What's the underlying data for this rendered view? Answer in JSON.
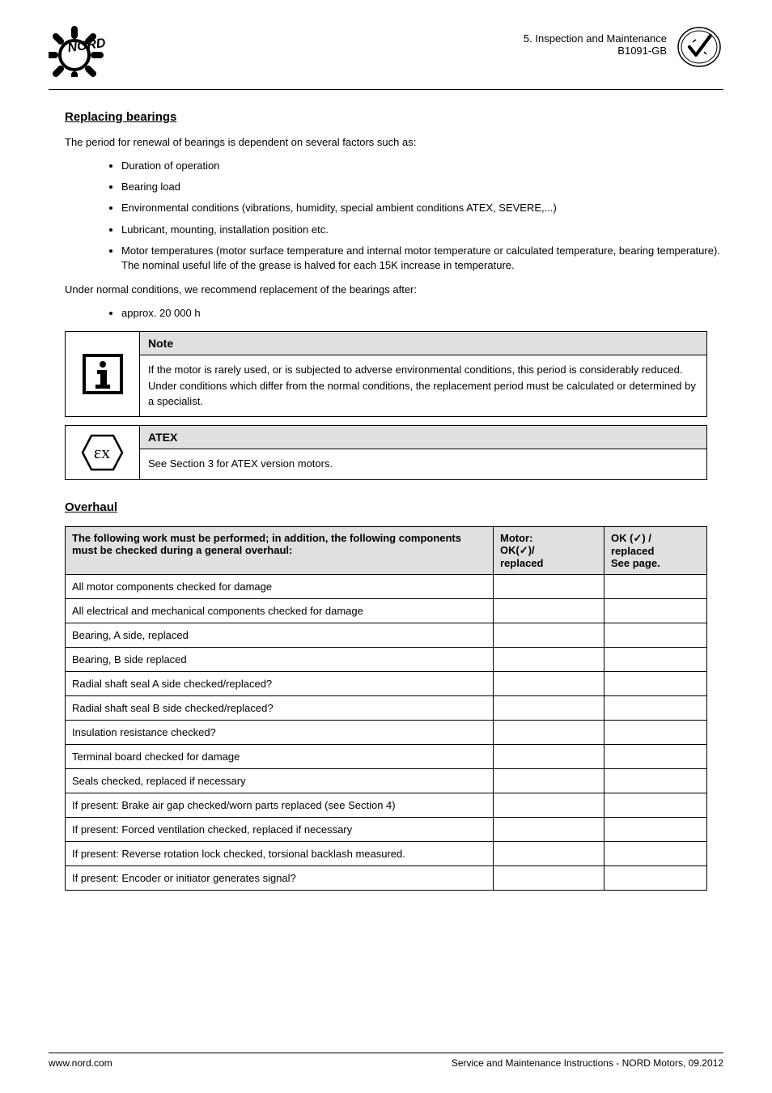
{
  "header": {
    "chapter": "5. Inspection and Maintenance",
    "doc_ref": "B1091-GB"
  },
  "sections": {
    "replacing_title": "Replacing bearings",
    "replacing_intro": "The period for renewal of bearings is dependent on several factors such as:",
    "factors": [
      "Duration of operation",
      "Bearing load",
      "Environmental conditions (vibrations, humidity, special ambient conditions ATEX, SEVERE,...)",
      "Lubricant, mounting, installation position etc.",
      "Motor temperatures (motor surface temperature and internal motor temperature or calculated temperature, bearing temperature). The nominal useful life of the grease is halved for each 15K increase in temperature."
    ],
    "replacing_conclusion": "Under normal conditions, we recommend replacement of the bearings after:",
    "replacing_hours": "approx. 20 000 h"
  },
  "callouts": {
    "note_title": "Note",
    "note_body": "If the motor is rarely used, or is subjected to adverse environmental conditions, this period is considerably reduced. Under conditions which differ from the normal conditions, the replacement period must be calculated or determined by a specialist.",
    "atex_title": "ATEX",
    "atex_body": "See Section 3 for ATEX version motors."
  },
  "overhaul": {
    "title": "Overhaul",
    "table_header": {
      "col1": "The following work must be performed; in addition, the following components must be checked during a general overhaul:",
      "col2": "Motor:\nOK(✓)/\nreplaced",
      "col3": "OK (✓) /\nreplaced\nSee page."
    },
    "rows": [
      {
        "task": "All motor components checked for damage"
      },
      {
        "task": "All electrical and mechanical components checked for damage"
      },
      {
        "task": "Bearing, A side, replaced"
      },
      {
        "task": "Bearing, B side replaced"
      },
      {
        "task": "Radial shaft seal A side checked/replaced?"
      },
      {
        "task": "Radial shaft seal B side checked/replaced?"
      },
      {
        "task": "Insulation resistance checked?"
      },
      {
        "task": "Terminal board checked for damage"
      },
      {
        "task": "Seals checked, replaced if necessary"
      },
      {
        "task": "If present: Brake air gap checked/worn parts replaced (see Section 4)"
      },
      {
        "task": "If present: Forced ventilation checked, replaced if necessary"
      },
      {
        "task": "If present: Reverse rotation lock checked, torsional backlash measured."
      },
      {
        "task": "If present: Encoder or initiator generates signal?"
      }
    ]
  },
  "footer": {
    "left": "www.nord.com",
    "right": "Service and Maintenance Instructions - NORD Motors, 09.2012"
  }
}
